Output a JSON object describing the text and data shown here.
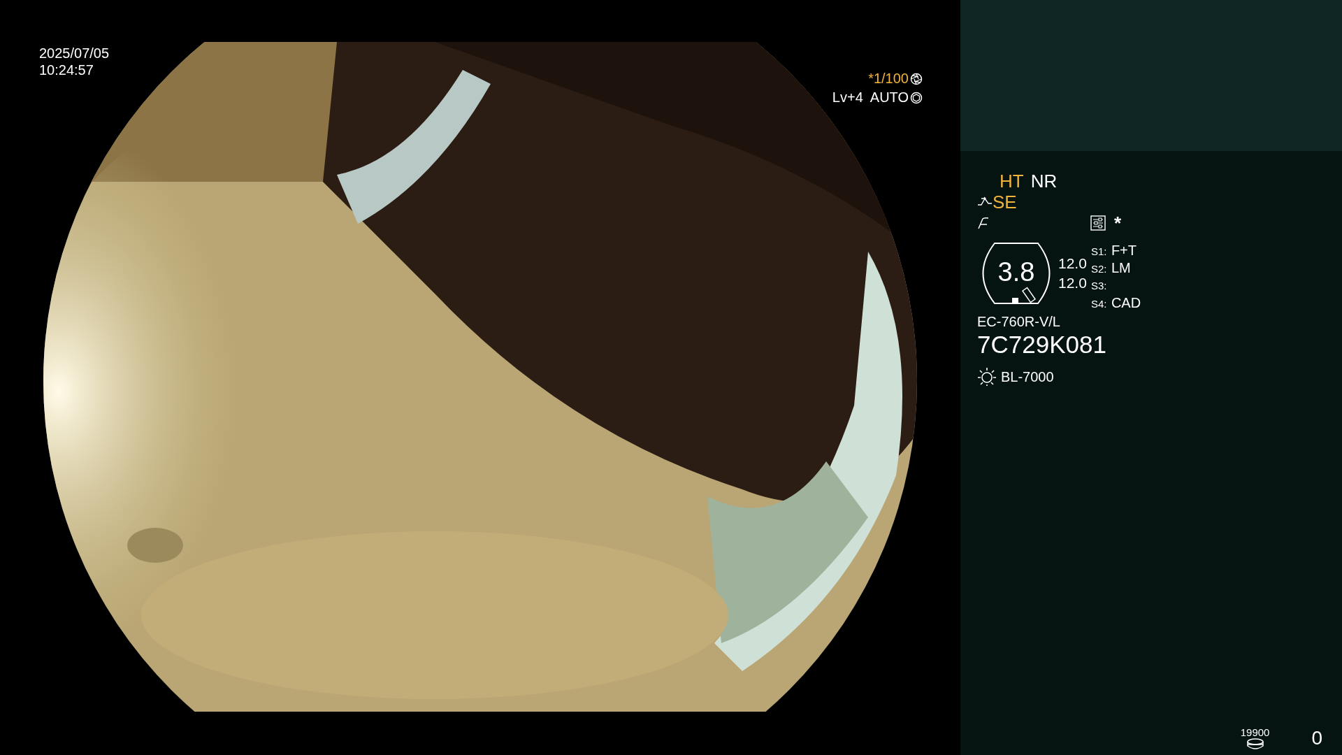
{
  "timestamp": {
    "date": "2025/07/05",
    "time": "10:24:57"
  },
  "exposure": {
    "shutter": "*1/100",
    "level": "Lv+4",
    "mode": "AUTO"
  },
  "panel": {
    "modes": [
      {
        "label": "HT",
        "color": "#f2b33a"
      },
      {
        "label": "NR",
        "color": "#ffffff"
      }
    ],
    "enhance": {
      "label": "SE",
      "color": "#f2b33a"
    },
    "asterisk": "*",
    "zoom": "3.8",
    "readings": [
      "12.0",
      "12.0"
    ],
    "switches": [
      {
        "label": "S1:",
        "value": "F+T"
      },
      {
        "label": "S2:",
        "value": "LM"
      },
      {
        "label": "S3:"
      },
      {
        "label": "S4:",
        "value": "CAD"
      }
    ],
    "scope_model": "EC-760R-V/L",
    "serial": "7C729K081",
    "light_source": "BL-7000"
  },
  "footer": {
    "capacity": "19900",
    "count": "0"
  }
}
